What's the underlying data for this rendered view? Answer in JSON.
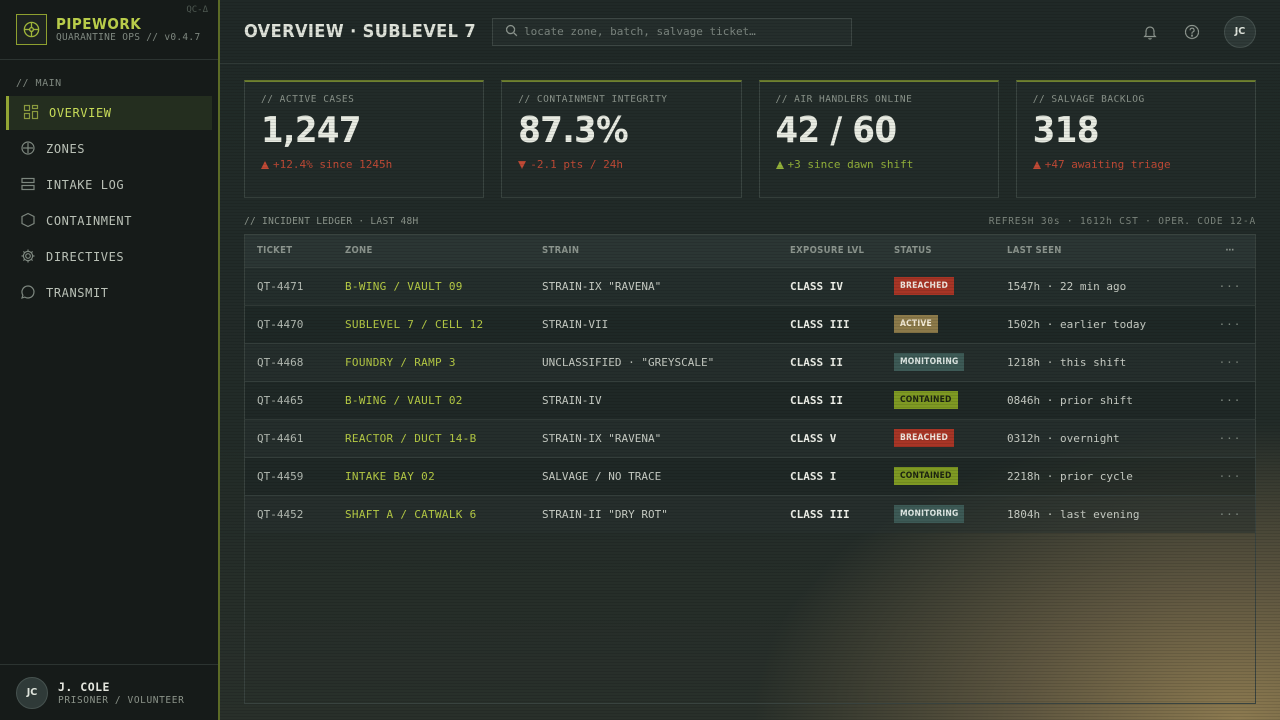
{
  "brand": {
    "name": "PIPEWORK",
    "subtitle": "QUARANTINE OPS // v0.4.7",
    "tag": "QC-Δ"
  },
  "sidebar": {
    "section_label": "// MAIN",
    "items": [
      {
        "label": "OVERVIEW",
        "icon": "dashboard-icon",
        "active": true
      },
      {
        "label": "ZONES",
        "icon": "crosshair-icon",
        "active": false
      },
      {
        "label": "INTAKE LOG",
        "icon": "stack-icon",
        "active": false
      },
      {
        "label": "CONTAINMENT",
        "icon": "hexagon-icon",
        "active": false
      },
      {
        "label": "DIRECTIVES",
        "icon": "gear-icon",
        "active": false
      },
      {
        "label": "TRANSMIT",
        "icon": "chat-icon",
        "active": false
      }
    ],
    "user": {
      "initials": "JC",
      "name": "J. COLE",
      "role": "PRISONER / VOLUNTEER"
    }
  },
  "header": {
    "title": "OVERVIEW · SUBLEVEL 7",
    "search_placeholder": "locate zone, batch, salvage ticket…",
    "avatar_initials": "JC"
  },
  "kpis": [
    {
      "label": "// ACTIVE CASES",
      "value": "1,247",
      "delta": "+12.4% since 1245h",
      "direction": "up",
      "tone": "red"
    },
    {
      "label": "// CONTAINMENT INTEGRITY",
      "value": "87.3%",
      "delta": "-2.1 pts / 24h",
      "direction": "down",
      "tone": "red"
    },
    {
      "label": "// AIR HANDLERS ONLINE",
      "value": "42 / 60",
      "delta": "+3 since dawn shift",
      "direction": "up",
      "tone": "green"
    },
    {
      "label": "// SALVAGE BACKLOG",
      "value": "318",
      "delta": "+47 awaiting triage",
      "direction": "up",
      "tone": "red"
    }
  ],
  "ledger": {
    "title": "// INCIDENT LEDGER · LAST 48H",
    "meta": "REFRESH 30s · 1612h CST · OPER. CODE 12-A",
    "columns": [
      "TICKET",
      "ZONE",
      "STRAIN",
      "EXPOSURE LVL",
      "STATUS",
      "LAST SEEN",
      "⋯"
    ],
    "rows": [
      {
        "ticket": "QT-4471",
        "zone": "B-WING / VAULT 09",
        "strain": "STRAIN-IX \"RAVENA\"",
        "exposure": "CLASS IV",
        "status": "BREACHED",
        "last_seen": "1547h · 22 min ago"
      },
      {
        "ticket": "QT-4470",
        "zone": "SUBLEVEL 7 / CELL 12",
        "strain": "STRAIN-VII",
        "exposure": "CLASS III",
        "status": "ACTIVE",
        "last_seen": "1502h · earlier today"
      },
      {
        "ticket": "QT-4468",
        "zone": "FOUNDRY / RAMP 3",
        "strain": "UNCLASSIFIED · \"GREYSCALE\"",
        "exposure": "CLASS II",
        "status": "MONITORING",
        "last_seen": "1218h · this shift"
      },
      {
        "ticket": "QT-4465",
        "zone": "B-WING / VAULT 02",
        "strain": "STRAIN-IV",
        "exposure": "CLASS II",
        "status": "CONTAINED",
        "last_seen": "0846h · prior shift"
      },
      {
        "ticket": "QT-4461",
        "zone": "REACTOR / DUCT 14-B",
        "strain": "STRAIN-IX \"RAVENA\"",
        "exposure": "CLASS V",
        "status": "BREACHED",
        "last_seen": "0312h · overnight"
      },
      {
        "ticket": "QT-4459",
        "zone": "INTAKE BAY 02",
        "strain": "SALVAGE / NO TRACE",
        "exposure": "CLASS I",
        "status": "CONTAINED",
        "last_seen": "2218h · prior cycle"
      },
      {
        "ticket": "QT-4452",
        "zone": "SHAFT A / CATWALK 6",
        "strain": "STRAIN-II \"DRY ROT\"",
        "exposure": "CLASS III",
        "status": "MONITORING",
        "last_seen": "1804h · last evening"
      }
    ],
    "row_action": "···"
  },
  "colors": {
    "accent": "#b8cc4a",
    "breached": "#a83526",
    "active": "#8c7a4a",
    "monitoring": "#3d5a56",
    "contained": "#7f9a23"
  }
}
